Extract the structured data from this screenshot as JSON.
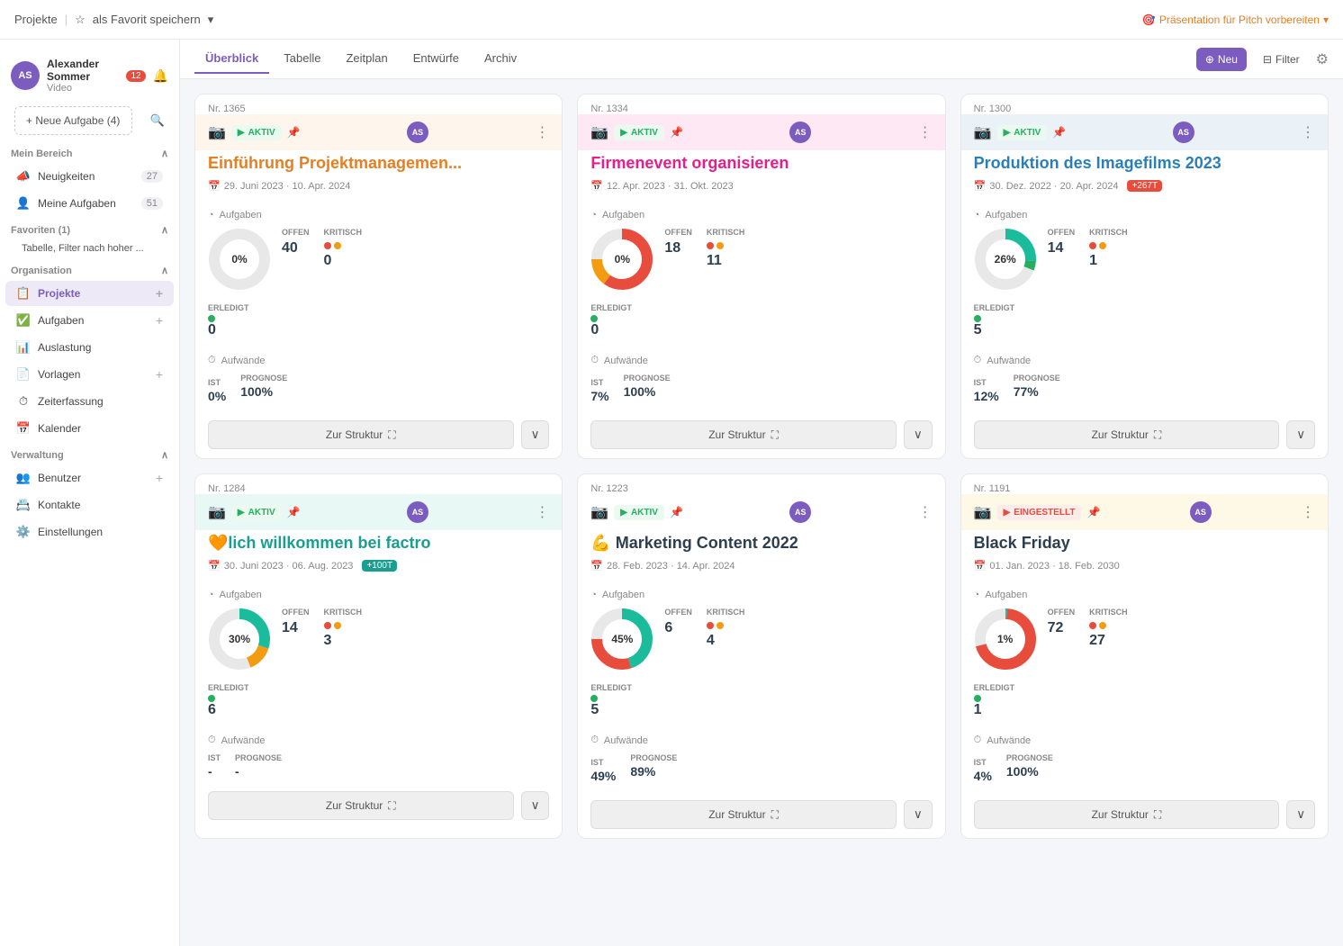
{
  "topbar": {
    "project_label": "Projekte",
    "favorite_label": "als Favorit speichern",
    "pitch_label": "Präsentation für Pitch vorbereiten"
  },
  "sidebar": {
    "user_name": "Alexander Sommer",
    "user_sub": "Video",
    "notif_count": "12",
    "new_task_label": "+ Neue Aufgabe (4)",
    "my_area_label": "Mein Bereich",
    "news_label": "Neuigkeiten",
    "news_count": "27",
    "tasks_label": "Meine Aufgaben",
    "tasks_count": "51",
    "favorites_label": "Favoriten (1)",
    "favorite_item": "Tabelle, Filter nach hoher ...",
    "org_label": "Organisation",
    "projects_label": "Projekte",
    "tasks_nav_label": "Aufgaben",
    "workload_label": "Auslastung",
    "templates_label": "Vorlagen",
    "time_label": "Zeiterfassung",
    "calendar_label": "Kalender",
    "admin_label": "Verwaltung",
    "users_label": "Benutzer",
    "contacts_label": "Kontakte",
    "settings_label": "Einstellungen"
  },
  "nav": {
    "tabs": [
      "Überblick",
      "Tabelle",
      "Zeitplan",
      "Entwürfe",
      "Archiv"
    ],
    "active_tab": 0,
    "new_label": "Neu",
    "filter_label": "Filter"
  },
  "projects": [
    {
      "number": "Nr. 1365",
      "status": "AKTIV",
      "status_type": "aktiv",
      "title": "Einführung Projektmanagemen...",
      "title_color": "orange",
      "bg": "bg-orange",
      "date": "29. Juni 2023 · 10. Apr. 2024",
      "date_badge": null,
      "donut_pct": 0,
      "donut_label": "0%",
      "donut_colors": [
        "#e8e8e8"
      ],
      "donut_slices": [
        {
          "pct": 100,
          "color": "#e8e8e8"
        }
      ],
      "offen": "40",
      "kritisch": "0",
      "erledigt": "0",
      "ist": "0%",
      "prognose": "100%",
      "progress_color": "#e74c3c",
      "progress_pct": 100
    },
    {
      "number": "Nr. 1334",
      "status": "AKTIV",
      "status_type": "aktiv",
      "title": "Firmenevent organisieren",
      "title_color": "pink",
      "bg": "bg-pink",
      "date": "12. Apr. 2023 · 31. Okt. 2023",
      "date_badge": null,
      "donut_pct": 0,
      "donut_label": "0%",
      "donut_slices": [
        {
          "pct": 60,
          "color": "#e74c3c"
        },
        {
          "pct": 15,
          "color": "#f39c12"
        },
        {
          "pct": 25,
          "color": "#e8e8e8"
        }
      ],
      "offen": "18",
      "kritisch": "11",
      "erledigt": "0",
      "ist": "7%",
      "prognose": "100%",
      "progress_color": "#3498db",
      "progress_pct": 100
    },
    {
      "number": "Nr. 1300",
      "status": "AKTIV",
      "status_type": "aktiv",
      "title": "Produktion des Imagefilms 2023",
      "title_color": "blue",
      "bg": "bg-blue",
      "date": "30. Dez. 2022 · 20. Apr. 2024",
      "date_badge": "+267T",
      "date_badge_color": "red",
      "donut_pct": 26,
      "donut_label": "26%",
      "donut_slices": [
        {
          "pct": 26,
          "color": "#1abc9c"
        },
        {
          "pct": 5,
          "color": "#27ae60"
        },
        {
          "pct": 69,
          "color": "#e8e8e8"
        }
      ],
      "offen": "14",
      "kritisch": "1",
      "erledigt": "5",
      "ist": "12%",
      "prognose": "77%",
      "progress_color": "#3498db",
      "progress_pct": 77
    },
    {
      "number": "Nr. 1284",
      "status": "AKTIV",
      "status_type": "aktiv",
      "title": "🧡lich willkommen bei factro",
      "title_color": "teal",
      "bg": "bg-teal",
      "date": "30. Juni 2023 · 06. Aug. 2023",
      "date_badge": "+100T",
      "date_badge_color": "teal",
      "donut_pct": 30,
      "donut_label": "30%",
      "donut_slices": [
        {
          "pct": 30,
          "color": "#1abc9c"
        },
        {
          "pct": 14,
          "color": "#f39c12"
        },
        {
          "pct": 56,
          "color": "#e8e8e8"
        }
      ],
      "offen": "14",
      "kritisch": "3",
      "erledigt": "6",
      "ist": "-",
      "prognose": "-",
      "progress_color": null,
      "progress_pct": 0
    },
    {
      "number": "Nr. 1223",
      "status": "AKTIV",
      "status_type": "aktiv",
      "title": "💪 Marketing Content 2022",
      "title_color": "black",
      "bg": "",
      "date": "28. Feb. 2023 · 14. Apr. 2024",
      "date_badge": null,
      "donut_pct": 45,
      "donut_label": "45%",
      "donut_slices": [
        {
          "pct": 45,
          "color": "#1abc9c"
        },
        {
          "pct": 30,
          "color": "#e74c3c"
        },
        {
          "pct": 25,
          "color": "#e8e8e8"
        }
      ],
      "offen": "6",
      "kritisch": "4",
      "erledigt": "5",
      "ist": "49%",
      "prognose": "89%",
      "progress_color": "#3498db",
      "progress_pct": 89
    },
    {
      "number": "Nr. 1191",
      "status": "EINGESTELLT",
      "status_type": "eingestellt",
      "title": "Black Friday",
      "title_color": "black",
      "bg": "bg-yellow",
      "date": "01. Jan. 2023 · 18. Feb. 2030",
      "date_badge": null,
      "donut_pct": 1,
      "donut_label": "1%",
      "donut_slices": [
        {
          "pct": 1,
          "color": "#1abc9c"
        },
        {
          "pct": 70,
          "color": "#e74c3c"
        },
        {
          "pct": 29,
          "color": "#e8e8e8"
        }
      ],
      "offen": "72",
      "kritisch": "27",
      "erledigt": "1",
      "ist": "4%",
      "prognose": "100%",
      "progress_color": "#3498db",
      "progress_pct": 100
    }
  ],
  "labels": {
    "aufgaben": "Aufgaben",
    "aufwaende": "Aufwände",
    "offen": "OFFEN",
    "kritisch": "KRITISCH",
    "erledigt": "ERLEDIGT",
    "ist": "IST",
    "prognose": "PROGNOSE",
    "zur_struktur": "Zur Struktur"
  }
}
